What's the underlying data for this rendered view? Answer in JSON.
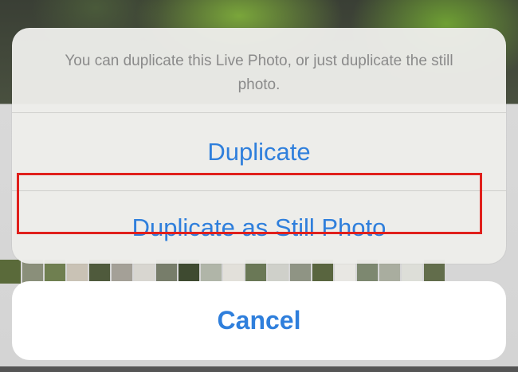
{
  "action_sheet": {
    "message": "You can duplicate this Live Photo, or just duplicate the still photo.",
    "options": [
      {
        "label": "Duplicate"
      },
      {
        "label": "Duplicate as Still Photo"
      }
    ],
    "cancel_label": "Cancel",
    "accent_color": "#2f7fdc",
    "highlight_color": "#e0201c"
  },
  "background": {
    "thumbnail_colors": [
      "#5a6a3a",
      "#8a8f7a",
      "#6f7f50",
      "#c9c2b5",
      "#4f5a3c",
      "#a4a097",
      "#d8d6d0",
      "#777d6a",
      "#3e4a30",
      "#b0b5a8",
      "#e2e0da",
      "#6a7856",
      "#cfd0ca",
      "#8f9484",
      "#59653f",
      "#e8e7e3",
      "#7d8870",
      "#a9ad9f",
      "#ddded8",
      "#626d4b"
    ]
  }
}
